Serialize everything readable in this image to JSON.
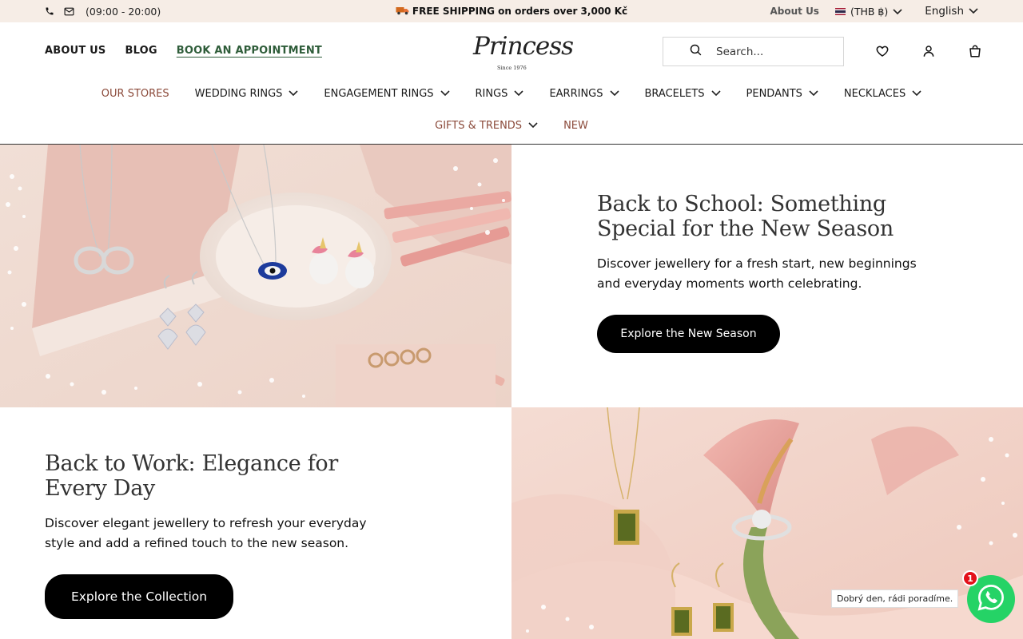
{
  "topbar": {
    "hours": "(09:00 - 20:00)",
    "shipping": "FREE SHIPPING on orders over 3,000 Kč",
    "about": "About Us",
    "currency": "(THB ฿)",
    "language": "English"
  },
  "header": {
    "nav": [
      "ABOUT US",
      "BLOG",
      "BOOK AN APPOINTMENT"
    ],
    "logo": {
      "name": "Princess",
      "since": "Since 1976"
    },
    "search_placeholder": "Search..."
  },
  "menu": {
    "row1": [
      {
        "label": "OUR STORES"
      },
      {
        "label": "WEDDING RINGS"
      },
      {
        "label": "ENGAGEMENT RINGS"
      },
      {
        "label": "RINGS"
      },
      {
        "label": "EARRINGS"
      },
      {
        "label": "BRACELETS"
      },
      {
        "label": "PENDANTS"
      },
      {
        "label": "NECKLACES"
      }
    ],
    "row2": [
      {
        "label": "GIFTS & TRENDS"
      },
      {
        "label": "NEW"
      }
    ]
  },
  "promo1": {
    "title": "Back to School: Something Special for the New Season",
    "description": "Discover jewellery for a fresh start, new beginnings and everyday moments worth celebrating.",
    "button": "Explore the New Season"
  },
  "promo2": {
    "title": "Back to Work: Elegance for Every Day",
    "description": "Discover elegant jewellery to refresh your everyday style and add a refined touch to the new season.",
    "button": "Explore the Collection"
  },
  "chat": {
    "greeting": "Dobrý den, rádi poradíme.",
    "badge": "1"
  },
  "colors": {
    "topbar_bg": "#f6ede6",
    "accent_brown": "#8b4a3a",
    "book_green": "#2f5d3a",
    "whatsapp": "#25d366"
  }
}
